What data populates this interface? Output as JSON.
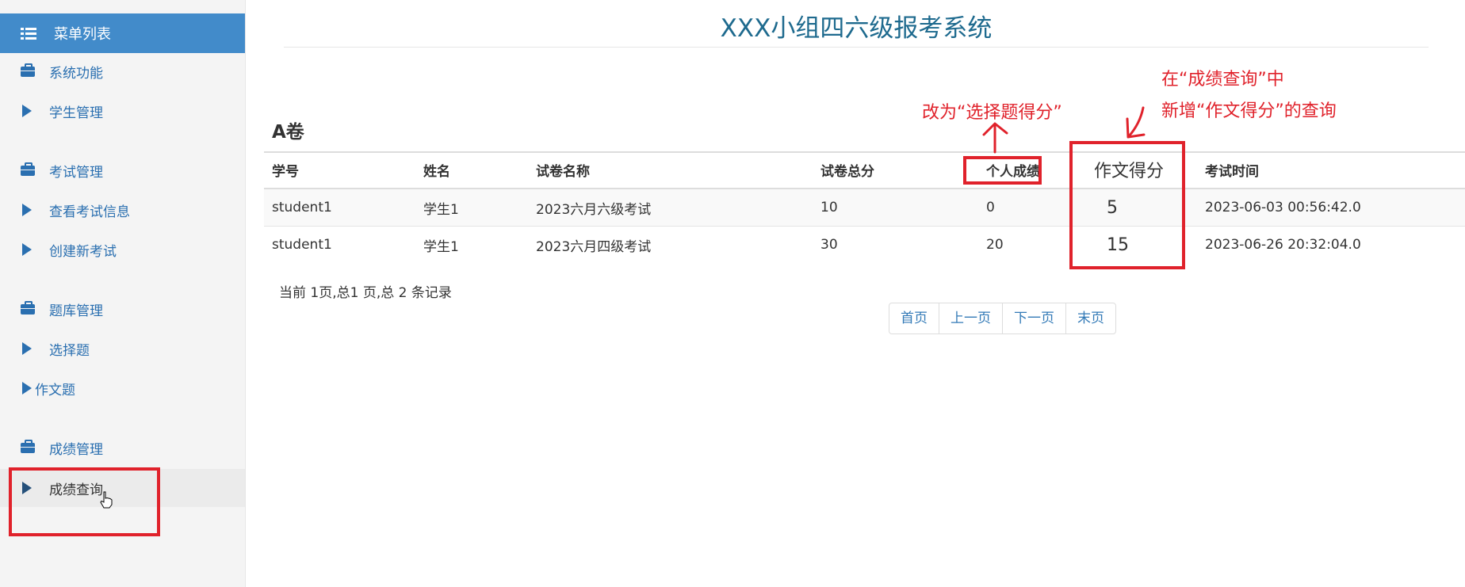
{
  "sidebar": {
    "header": "菜单列表",
    "items": [
      {
        "label": "系统功能",
        "icon": "briefcase-icon"
      },
      {
        "label": "学生管理",
        "icon": "triangle-right-icon"
      },
      {
        "label": "考试管理",
        "icon": "briefcase-icon"
      },
      {
        "label": "查看考试信息",
        "icon": "triangle-right-icon"
      },
      {
        "label": "创建新考试",
        "icon": "triangle-right-icon"
      },
      {
        "label": "题库管理",
        "icon": "briefcase-icon"
      },
      {
        "label": "选择题",
        "icon": "triangle-right-icon"
      },
      {
        "label": "作文题",
        "icon": "triangle-right-icon"
      },
      {
        "label": "成绩管理",
        "icon": "briefcase-icon"
      },
      {
        "label": "成绩查询",
        "icon": "triangle-right-icon",
        "active": true
      }
    ]
  },
  "page": {
    "title": "XXX小组四六级报考系统",
    "section_title": "A卷"
  },
  "table": {
    "headers": [
      "学号",
      "姓名",
      "试卷名称",
      "试卷总分",
      "个人成绩",
      "作文得分",
      "考试时间"
    ],
    "rows": [
      [
        "student1",
        "学生1",
        "2023六月六级考试",
        "10",
        "0",
        "5",
        "2023-06-03 00:56:42.0"
      ],
      [
        "student1",
        "学生1",
        "2023六月四级考试",
        "30",
        "20",
        "15",
        "2023-06-26 20:32:04.0"
      ]
    ]
  },
  "pagination": {
    "info": "当前 1页,总1 页,总 2 条记录",
    "buttons": [
      "首页",
      "上一页",
      "下一页",
      "末页"
    ]
  },
  "annotations": {
    "rename_note": "改为“选择题得分”",
    "add_note_line1": "在“成绩查询”中",
    "add_note_line2": "新增“作文得分”的查询",
    "color": "#e0222b"
  }
}
